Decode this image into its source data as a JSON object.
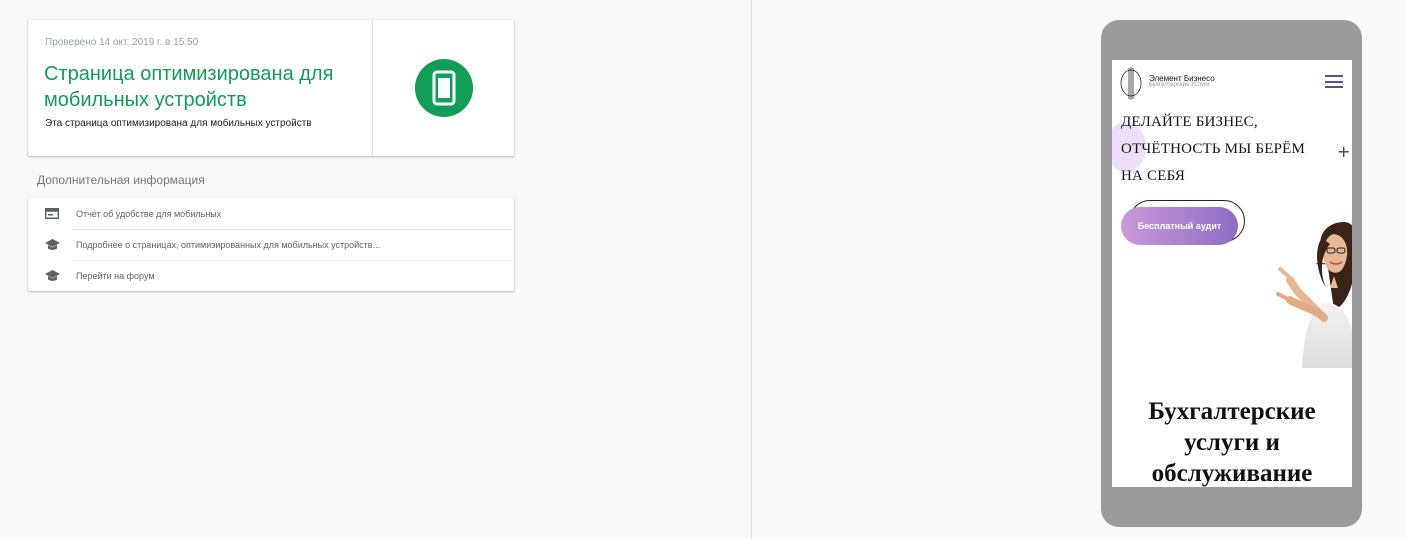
{
  "result": {
    "checked_date": "Проверено 14 окт. 2019 г. в 15:50",
    "title": "Страница оптимизирована для мобильных устройств",
    "description": "Эта страница оптимизирована для мобильных устройств",
    "status_color": "#0f9d58",
    "status_icon": "smartphone-icon"
  },
  "additional_info": {
    "heading": "Дополнительная информация",
    "items": [
      {
        "label": "Отчет об удобстве для мобильных",
        "icon": "report-icon"
      },
      {
        "label": "Подробнее о страницах, оптимизированных для мобильных устройств...",
        "icon": "graduation-cap-icon"
      },
      {
        "label": "Перейти на форум",
        "icon": "graduation-cap-icon"
      }
    ]
  },
  "preview": {
    "site_name": "Элемент Бизнесо",
    "site_tagline": "Бухгалтерские Услуги",
    "hero_lines": [
      "ДЕЛАЙТЕ БИЗНЕС,",
      "ОТЧЁТНОСТЬ МЫ БЕРЁМ",
      "НА СЕБЯ"
    ],
    "audit_button": "Бесплатный аудит",
    "section_lines": [
      "Бухгалтерские",
      "услуги и",
      "обслуживание"
    ],
    "accent_color": "#5b4aa8"
  }
}
